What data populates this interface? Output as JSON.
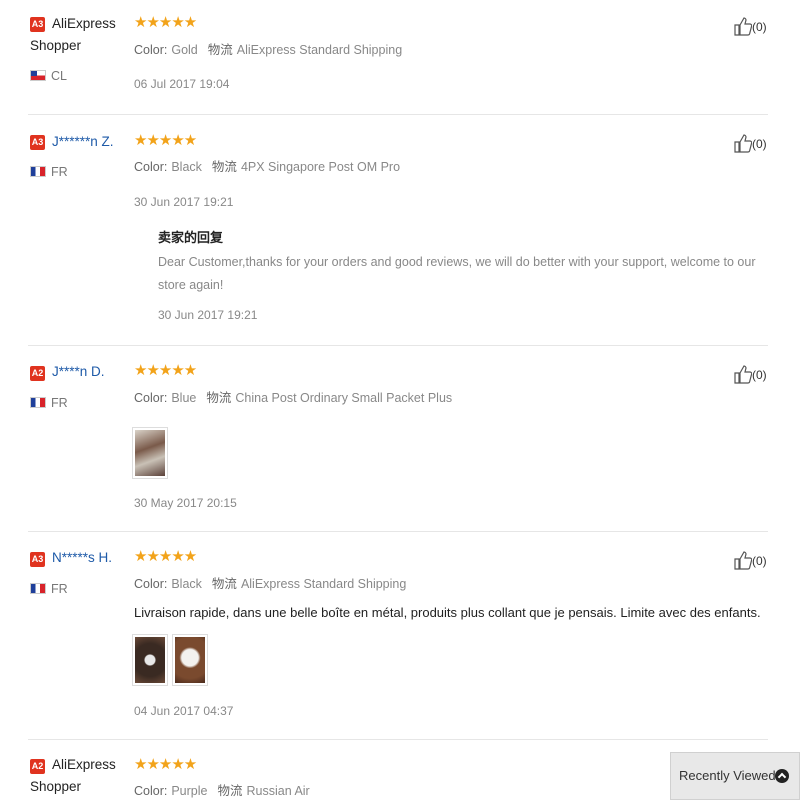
{
  "reviews": [
    {
      "badge": "A3",
      "name_line1": "AliExpress",
      "name_line2": "Shopper",
      "country": "CL",
      "stars": "★★★★★",
      "color_key": "Color:",
      "color_val": "Gold",
      "ship_key": "物流",
      "ship_val": "AliExpress Standard Shipping",
      "date": "06 Jul 2017 19:04",
      "helpful": "(0)"
    },
    {
      "badge": "A3",
      "name": "J******n Z.",
      "country": "FR",
      "stars": "★★★★★",
      "color_key": "Color:",
      "color_val": "Black",
      "ship_key": "物流",
      "ship_val": "4PX Singapore Post OM Pro",
      "date": "30 Jun 2017 19:21",
      "helpful": "(0)",
      "reply_title": "卖家的回复",
      "reply_text": "Dear Customer,thanks for your orders and good reviews, we will do better with your support, welcome to our store again!",
      "reply_date": "30 Jun 2017 19:21"
    },
    {
      "badge": "A2",
      "name": "J****n D.",
      "country": "FR",
      "stars": "★★★★★",
      "color_key": "Color:",
      "color_val": "Blue",
      "ship_key": "物流",
      "ship_val": "China Post Ordinary Small Packet Plus",
      "date": "30 May 2017 20:15",
      "helpful": "(0)"
    },
    {
      "badge": "A3",
      "name": "N*****s H.",
      "country": "FR",
      "stars": "★★★★★",
      "color_key": "Color:",
      "color_val": "Black",
      "ship_key": "物流",
      "ship_val": "AliExpress Standard Shipping",
      "comment": "Livraison rapide, dans une belle boîte en métal, produits plus collant que je pensais. Limite avec des enfants.",
      "date": "04 Jun 2017 04:37",
      "helpful": "(0)"
    },
    {
      "badge": "A2",
      "name_line1": "AliExpress",
      "name_line2": "Shopper",
      "stars": "★★★★★",
      "color_key": "Color:",
      "color_val": "Purple",
      "ship_key": "物流",
      "ship_val": "Russian Air"
    }
  ],
  "recently_viewed": "Recently Viewed",
  "colors": {
    "star": "#f2a31a",
    "badge": "#e0331f",
    "link": "#1e5aa8"
  }
}
